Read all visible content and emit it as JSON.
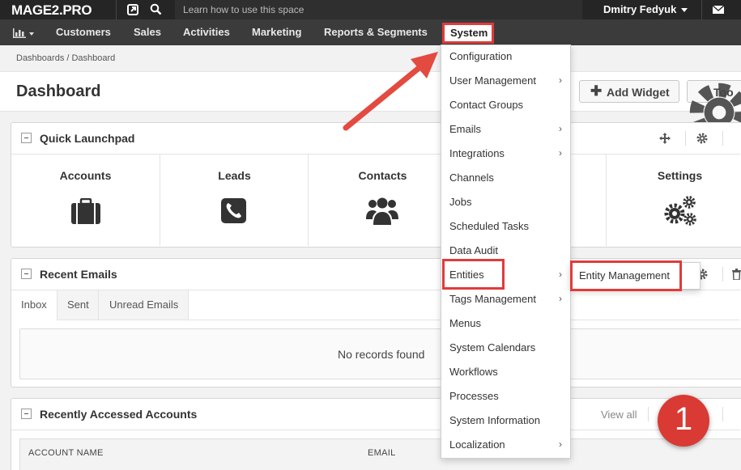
{
  "topbar": {
    "logo": "MAGE2.PRO",
    "help_text": "Learn how to use this space",
    "user_name": "Dmitry Fedyuk"
  },
  "nav": {
    "items": [
      "Customers",
      "Sales",
      "Activities",
      "Marketing",
      "Reports & Segments"
    ],
    "system": "System"
  },
  "page": {
    "breadcrumb": "Dashboards / Dashboard",
    "title": "Dashboard",
    "add_widget": "Add Widget",
    "tools": "Too"
  },
  "launchpad": {
    "title": "Quick Launchpad",
    "items": [
      "Accounts",
      "Leads",
      "Contacts",
      "Settings"
    ]
  },
  "emails": {
    "title": "Recent Emails",
    "tabs": [
      "Inbox",
      "Sent",
      "Unread Emails"
    ],
    "empty": "No records found"
  },
  "accounts": {
    "title": "Recently Accessed Accounts",
    "view_all": "View all",
    "columns": [
      "ACCOUNT NAME",
      "EMAIL"
    ]
  },
  "system_menu": {
    "items": [
      {
        "label": "Configuration",
        "submenu": false
      },
      {
        "label": "User Management",
        "submenu": true
      },
      {
        "label": "Contact Groups",
        "submenu": false
      },
      {
        "label": "Emails",
        "submenu": true
      },
      {
        "label": "Integrations",
        "submenu": true
      },
      {
        "label": "Channels",
        "submenu": false
      },
      {
        "label": "Jobs",
        "submenu": false
      },
      {
        "label": "Scheduled Tasks",
        "submenu": false
      },
      {
        "label": "Data Audit",
        "submenu": false
      },
      {
        "label": "Entities",
        "submenu": true
      },
      {
        "label": "Tags Management",
        "submenu": true
      },
      {
        "label": "Menus",
        "submenu": false
      },
      {
        "label": "System Calendars",
        "submenu": false
      },
      {
        "label": "Workflows",
        "submenu": false
      },
      {
        "label": "Processes",
        "submenu": false
      },
      {
        "label": "System Information",
        "submenu": false
      },
      {
        "label": "Localization",
        "submenu": true
      }
    ],
    "submenu_label": "Entity Management"
  },
  "annotation": {
    "badge": "1",
    "color": "#e03b3b"
  }
}
